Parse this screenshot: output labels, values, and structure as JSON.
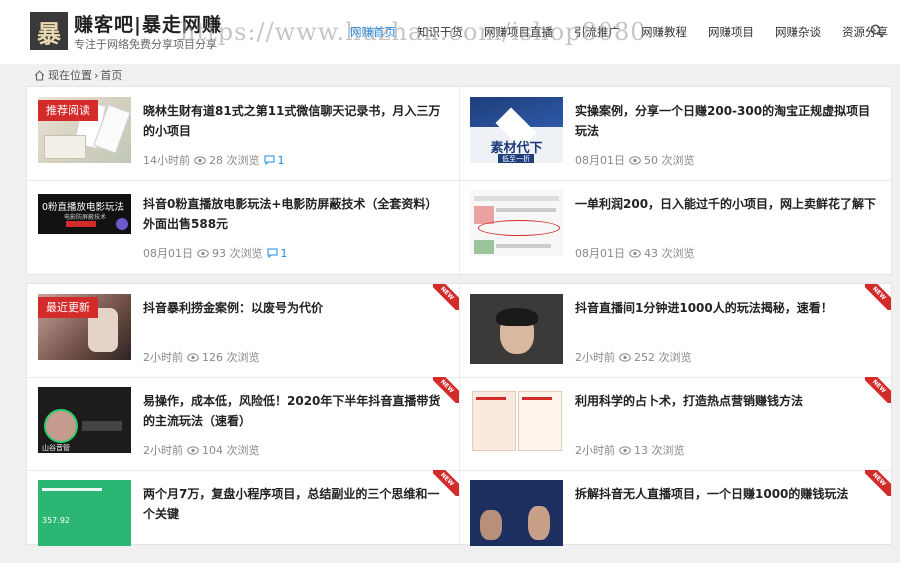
{
  "header": {
    "logo_char": "暴",
    "site_title": "赚客吧|暴走网赚",
    "site_subtitle": "专注于网络免费分享项目分享",
    "watermark": "https://www.huzhan.com/ishop8080",
    "nav": [
      "网赚首页",
      "知识干货",
      "网赚项目直播",
      "引流推广",
      "网赚教程",
      "网赚项目",
      "网赚杂谈",
      "资源分享"
    ],
    "search_icon": "search-icon"
  },
  "breadcrumb": {
    "label": "现在位置",
    "sep": "›",
    "current": "首页"
  },
  "recommend": {
    "badge": "推荐阅读",
    "items": [
      {
        "title": "晓林生财有道81式之第11式微信聊天记录书，月入三万的小项目",
        "time": "14小时前",
        "views": "28 次浏览",
        "comments": "1"
      },
      {
        "title": "实操案例，分享一个日赚200-300的淘宝正规虚拟项目玩法",
        "time": "08月01日",
        "views": "50 次浏览",
        "comments": ""
      },
      {
        "title": "抖音0粉直播放电影玩法+电影防屏蔽技术（全套资料）外面出售588元",
        "time": "08月01日",
        "views": "93 次浏览",
        "comments": "1",
        "thumb_text": "0粉直播放电影玩法",
        "thumb_sub": "电影防屏蔽技术"
      },
      {
        "title": "一单利润200，日入能过千的小项目，网上卖鲜花了解下",
        "time": "08月01日",
        "views": "43 次浏览",
        "comments": ""
      }
    ],
    "thumb2_text": "素材代下",
    "thumb2_sub": "低至一折"
  },
  "latest": {
    "badge": "最近更新",
    "new_label": "NEW",
    "items": [
      {
        "title": "抖音暴利捞金案例：以废号为代价",
        "time": "2小时前",
        "views": "126 次浏览"
      },
      {
        "title": "抖音直播间1分钟进1000人的玩法揭秘，速看！",
        "time": "2小时前",
        "views": "252 次浏览"
      },
      {
        "title": "易操作，成本低，风险低！2020年下半年抖音直播带货的主流玩法（速看）",
        "time": "2小时前",
        "views": "104 次浏览",
        "thumb_text": "山谷音管"
      },
      {
        "title": "利用科学的占卜术，打造热点营销赚钱方法",
        "time": "2小时前",
        "views": "13 次浏览"
      },
      {
        "title": "两个月7万，复盘小程序项目，总结副业的三个思维和一个关键",
        "time": "",
        "views": "",
        "thumb_text": "357.92"
      },
      {
        "title": "拆解抖音无人直播项目，一个日赚1000的赚钱玩法",
        "time": "",
        "views": ""
      }
    ]
  }
}
